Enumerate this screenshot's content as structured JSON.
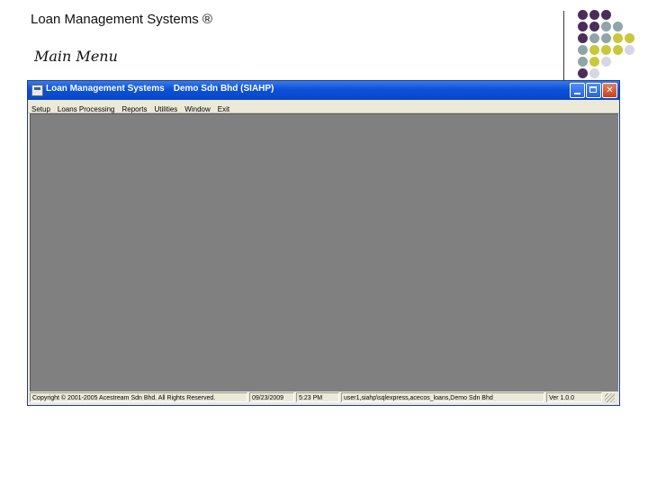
{
  "slide": {
    "title": "Loan Management Systems ®",
    "subtitle": "Main Menu"
  },
  "decoration": {
    "dot_colors": {
      "purple": "#4b2d5c",
      "teal": "#8fa5a8",
      "yellow": "#c8c83a",
      "lavender": "#d8d6e6"
    },
    "rows": [
      [
        "purple",
        "purple",
        "purple",
        null,
        null
      ],
      [
        "purple",
        "purple",
        "teal",
        "teal",
        null
      ],
      [
        "purple",
        "teal",
        "teal",
        "yellow",
        "yellow"
      ],
      [
        "teal",
        "yellow",
        "yellow",
        "yellow",
        "lavender"
      ],
      [
        "teal",
        "yellow",
        "lavender",
        null,
        null
      ],
      [
        "purple",
        "lavender",
        null,
        null,
        null
      ]
    ]
  },
  "window": {
    "app_name": "Loan Management Systems",
    "company": "Demo Sdn Bhd (SIAHP)",
    "title_bar_color": "#0a50d8",
    "controls": {
      "minimize": "minimize-icon",
      "maximize": "maximize-icon",
      "close_glyph": "✕"
    },
    "menu": [
      "Setup",
      "Loans Processing",
      "Reports",
      "Utilities",
      "Window",
      "Exit"
    ],
    "workspace_color": "#808080",
    "status": {
      "copyright": "Copyright © 2001-2005 Acestream Sdn Bhd. All Rights Reserved.",
      "date": "09/23/2009",
      "time": "5:23 PM",
      "connection": "user1,siahp\\sqlexpress,acecos_loans,Demo Sdn Bhd",
      "version": "Ver 1.0.0"
    }
  }
}
